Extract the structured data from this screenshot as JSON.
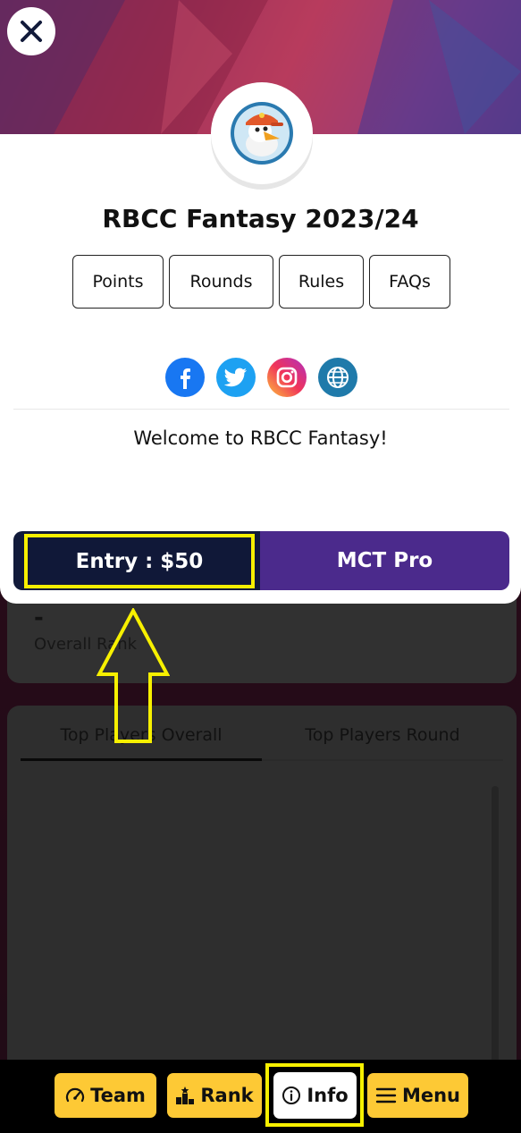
{
  "background": {
    "rank_value": "-",
    "rank_label": "Overall Rank",
    "tabs": [
      "Top Players Overall",
      "Top Players Round"
    ]
  },
  "modal": {
    "title": "RBCC Fantasy 2023/24",
    "nav_buttons": [
      "Points",
      "Rounds",
      "Rules",
      "FAQs"
    ],
    "welcome_text": "Welcome to RBCC Fantasy!",
    "entry_label": "Entry : $50",
    "pro_label": "MCT Pro",
    "social_icons": [
      "facebook-icon",
      "twitter-icon",
      "instagram-icon",
      "globe-icon"
    ]
  },
  "bottom_nav": {
    "items": [
      "Team",
      "Rank",
      "Info",
      "Menu"
    ],
    "active": "Info"
  },
  "colors": {
    "accent_yellow": "#fdc935",
    "highlight": "#f7f000",
    "entry_bg": "#111a3a",
    "pro_bg": "#4b2a8c"
  }
}
